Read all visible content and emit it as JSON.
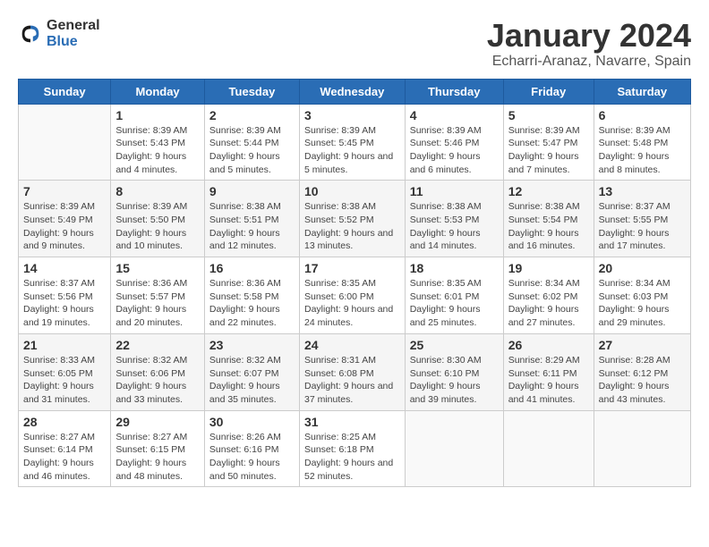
{
  "logo": {
    "text_general": "General",
    "text_blue": "Blue"
  },
  "title": "January 2024",
  "subtitle": "Echarri-Aranaz, Navarre, Spain",
  "days_of_week": [
    "Sunday",
    "Monday",
    "Tuesday",
    "Wednesday",
    "Thursday",
    "Friday",
    "Saturday"
  ],
  "weeks": [
    [
      {
        "day": "",
        "sunrise": "",
        "sunset": "",
        "daylight": ""
      },
      {
        "day": "1",
        "sunrise": "Sunrise: 8:39 AM",
        "sunset": "Sunset: 5:43 PM",
        "daylight": "Daylight: 9 hours and 4 minutes."
      },
      {
        "day": "2",
        "sunrise": "Sunrise: 8:39 AM",
        "sunset": "Sunset: 5:44 PM",
        "daylight": "Daylight: 9 hours and 5 minutes."
      },
      {
        "day": "3",
        "sunrise": "Sunrise: 8:39 AM",
        "sunset": "Sunset: 5:45 PM",
        "daylight": "Daylight: 9 hours and 5 minutes."
      },
      {
        "day": "4",
        "sunrise": "Sunrise: 8:39 AM",
        "sunset": "Sunset: 5:46 PM",
        "daylight": "Daylight: 9 hours and 6 minutes."
      },
      {
        "day": "5",
        "sunrise": "Sunrise: 8:39 AM",
        "sunset": "Sunset: 5:47 PM",
        "daylight": "Daylight: 9 hours and 7 minutes."
      },
      {
        "day": "6",
        "sunrise": "Sunrise: 8:39 AM",
        "sunset": "Sunset: 5:48 PM",
        "daylight": "Daylight: 9 hours and 8 minutes."
      }
    ],
    [
      {
        "day": "7",
        "sunrise": "Sunrise: 8:39 AM",
        "sunset": "Sunset: 5:49 PM",
        "daylight": "Daylight: 9 hours and 9 minutes."
      },
      {
        "day": "8",
        "sunrise": "Sunrise: 8:39 AM",
        "sunset": "Sunset: 5:50 PM",
        "daylight": "Daylight: 9 hours and 10 minutes."
      },
      {
        "day": "9",
        "sunrise": "Sunrise: 8:38 AM",
        "sunset": "Sunset: 5:51 PM",
        "daylight": "Daylight: 9 hours and 12 minutes."
      },
      {
        "day": "10",
        "sunrise": "Sunrise: 8:38 AM",
        "sunset": "Sunset: 5:52 PM",
        "daylight": "Daylight: 9 hours and 13 minutes."
      },
      {
        "day": "11",
        "sunrise": "Sunrise: 8:38 AM",
        "sunset": "Sunset: 5:53 PM",
        "daylight": "Daylight: 9 hours and 14 minutes."
      },
      {
        "day": "12",
        "sunrise": "Sunrise: 8:38 AM",
        "sunset": "Sunset: 5:54 PM",
        "daylight": "Daylight: 9 hours and 16 minutes."
      },
      {
        "day": "13",
        "sunrise": "Sunrise: 8:37 AM",
        "sunset": "Sunset: 5:55 PM",
        "daylight": "Daylight: 9 hours and 17 minutes."
      }
    ],
    [
      {
        "day": "14",
        "sunrise": "Sunrise: 8:37 AM",
        "sunset": "Sunset: 5:56 PM",
        "daylight": "Daylight: 9 hours and 19 minutes."
      },
      {
        "day": "15",
        "sunrise": "Sunrise: 8:36 AM",
        "sunset": "Sunset: 5:57 PM",
        "daylight": "Daylight: 9 hours and 20 minutes."
      },
      {
        "day": "16",
        "sunrise": "Sunrise: 8:36 AM",
        "sunset": "Sunset: 5:58 PM",
        "daylight": "Daylight: 9 hours and 22 minutes."
      },
      {
        "day": "17",
        "sunrise": "Sunrise: 8:35 AM",
        "sunset": "Sunset: 6:00 PM",
        "daylight": "Daylight: 9 hours and 24 minutes."
      },
      {
        "day": "18",
        "sunrise": "Sunrise: 8:35 AM",
        "sunset": "Sunset: 6:01 PM",
        "daylight": "Daylight: 9 hours and 25 minutes."
      },
      {
        "day": "19",
        "sunrise": "Sunrise: 8:34 AM",
        "sunset": "Sunset: 6:02 PM",
        "daylight": "Daylight: 9 hours and 27 minutes."
      },
      {
        "day": "20",
        "sunrise": "Sunrise: 8:34 AM",
        "sunset": "Sunset: 6:03 PM",
        "daylight": "Daylight: 9 hours and 29 minutes."
      }
    ],
    [
      {
        "day": "21",
        "sunrise": "Sunrise: 8:33 AM",
        "sunset": "Sunset: 6:05 PM",
        "daylight": "Daylight: 9 hours and 31 minutes."
      },
      {
        "day": "22",
        "sunrise": "Sunrise: 8:32 AM",
        "sunset": "Sunset: 6:06 PM",
        "daylight": "Daylight: 9 hours and 33 minutes."
      },
      {
        "day": "23",
        "sunrise": "Sunrise: 8:32 AM",
        "sunset": "Sunset: 6:07 PM",
        "daylight": "Daylight: 9 hours and 35 minutes."
      },
      {
        "day": "24",
        "sunrise": "Sunrise: 8:31 AM",
        "sunset": "Sunset: 6:08 PM",
        "daylight": "Daylight: 9 hours and 37 minutes."
      },
      {
        "day": "25",
        "sunrise": "Sunrise: 8:30 AM",
        "sunset": "Sunset: 6:10 PM",
        "daylight": "Daylight: 9 hours and 39 minutes."
      },
      {
        "day": "26",
        "sunrise": "Sunrise: 8:29 AM",
        "sunset": "Sunset: 6:11 PM",
        "daylight": "Daylight: 9 hours and 41 minutes."
      },
      {
        "day": "27",
        "sunrise": "Sunrise: 8:28 AM",
        "sunset": "Sunset: 6:12 PM",
        "daylight": "Daylight: 9 hours and 43 minutes."
      }
    ],
    [
      {
        "day": "28",
        "sunrise": "Sunrise: 8:27 AM",
        "sunset": "Sunset: 6:14 PM",
        "daylight": "Daylight: 9 hours and 46 minutes."
      },
      {
        "day": "29",
        "sunrise": "Sunrise: 8:27 AM",
        "sunset": "Sunset: 6:15 PM",
        "daylight": "Daylight: 9 hours and 48 minutes."
      },
      {
        "day": "30",
        "sunrise": "Sunrise: 8:26 AM",
        "sunset": "Sunset: 6:16 PM",
        "daylight": "Daylight: 9 hours and 50 minutes."
      },
      {
        "day": "31",
        "sunrise": "Sunrise: 8:25 AM",
        "sunset": "Sunset: 6:18 PM",
        "daylight": "Daylight: 9 hours and 52 minutes."
      },
      {
        "day": "",
        "sunrise": "",
        "sunset": "",
        "daylight": ""
      },
      {
        "day": "",
        "sunrise": "",
        "sunset": "",
        "daylight": ""
      },
      {
        "day": "",
        "sunrise": "",
        "sunset": "",
        "daylight": ""
      }
    ]
  ]
}
